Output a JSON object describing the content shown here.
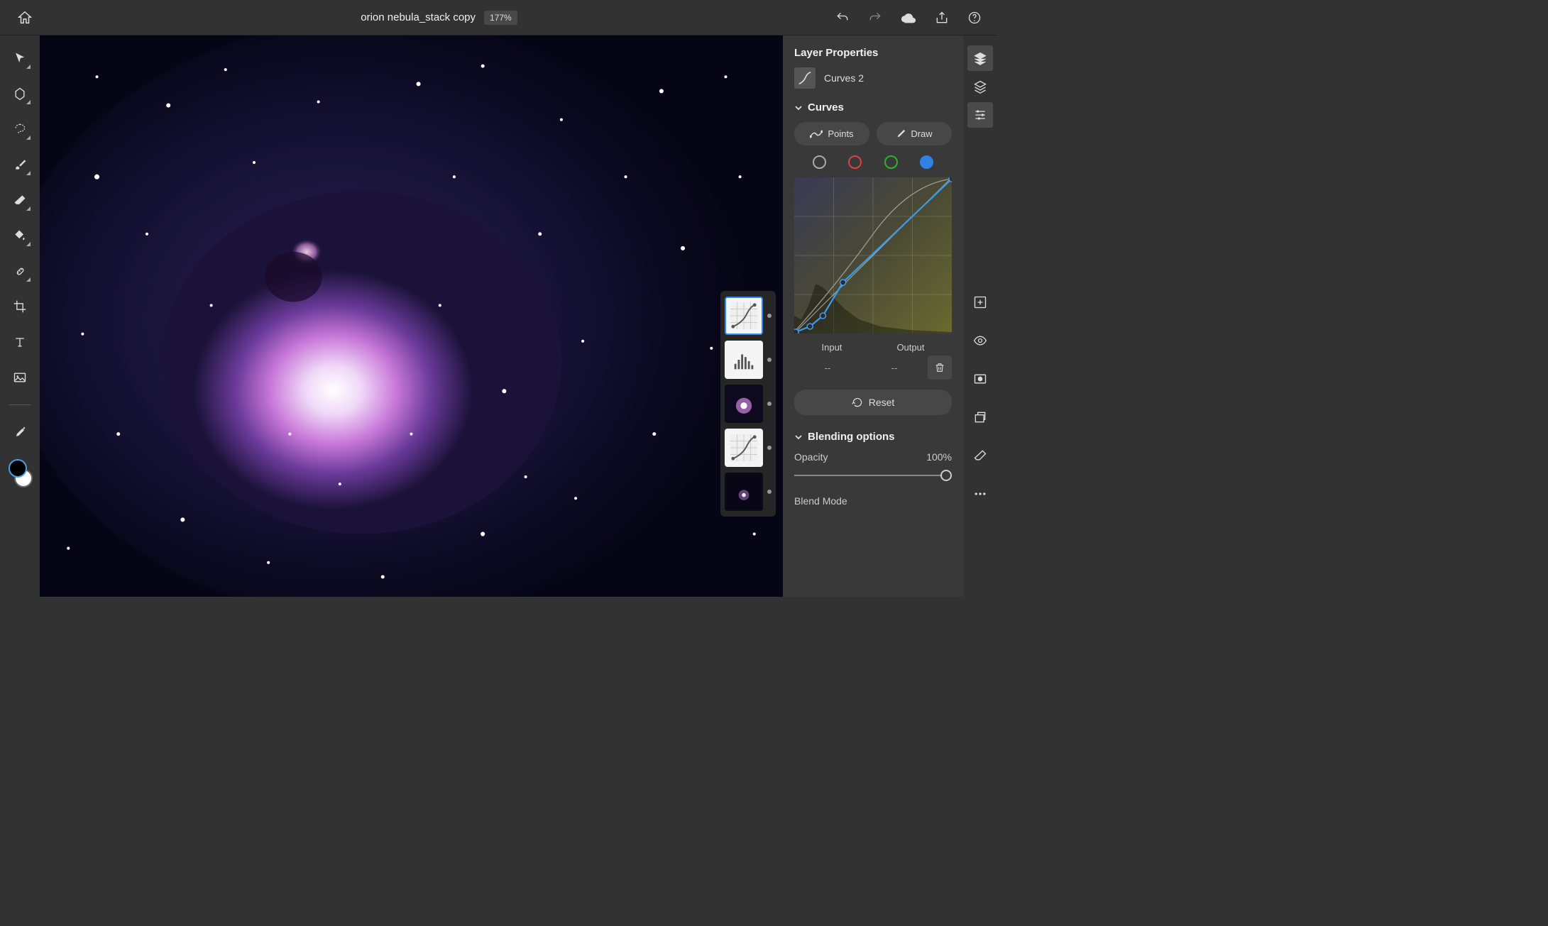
{
  "header": {
    "title": "orion nebula_stack copy",
    "zoom": "177%"
  },
  "panel": {
    "title": "Layer Properties",
    "layer_name": "Curves 2",
    "curves_section": "Curves",
    "points_label": "Points",
    "draw_label": "Draw",
    "input_label": "Input",
    "output_label": "Output",
    "input_value": "--",
    "output_value": "--",
    "reset_label": "Reset",
    "blending_section": "Blending options",
    "opacity_label": "Opacity",
    "opacity_value": "100%",
    "blend_mode_label": "Blend Mode"
  },
  "colors": {
    "foreground": "#000000",
    "background": "#ffffff",
    "accent": "#2d8ceb"
  }
}
